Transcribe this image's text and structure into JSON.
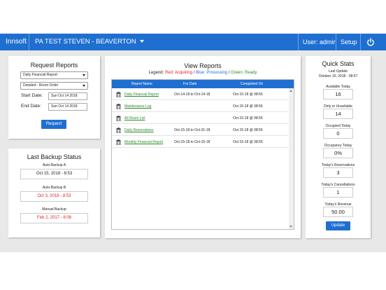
{
  "colors": {
    "accent": "#1f6fd1",
    "red": "#e02020",
    "blue": "#1f6fd1",
    "green": "#2a8a2a"
  },
  "header": {
    "brand": "Innsoft",
    "property": "PA TEST STEVEN - BEAVERTON",
    "user": "User: admin",
    "setup": "Setup",
    "power_icon": "power-icon"
  },
  "request": {
    "title": "Request Reports",
    "report_select": "Daily Financial Report",
    "order_select": "Detailed - Room Order",
    "start_label": "Start Date:",
    "start_value": "Sun Oct 14 2018",
    "end_label": "End Date:",
    "end_value": "Sun Oct 14 2018",
    "button": "Request"
  },
  "backup": {
    "title": "Last Backup Status",
    "items": [
      {
        "label": "Auto-Backup A",
        "value": "Oct 15, 2018 - 8:53",
        "color": "#222222"
      },
      {
        "label": "Auto-Backup B",
        "value": "Oct 3, 2018 - 8:53",
        "color": "#e02020"
      },
      {
        "label": "Manual Backup",
        "value": "Feb 2, 2017 - 8:08",
        "color": "#e02020"
      }
    ]
  },
  "view": {
    "title": "View Reports",
    "legend": {
      "prefix": "Legend: ",
      "red": "Red: Acquiring",
      "blue": "Blue: Processing",
      "green": "Green: Ready"
    },
    "columns": [
      "Report Name",
      "For Date",
      "Completed On"
    ],
    "rows": [
      {
        "name": "Daily Financial Report",
        "for_date": "Oct-14-18 to Oct-14-18",
        "completed": "Oct-15-18 @ 08:56"
      },
      {
        "name": "Maintenance Log",
        "for_date": "",
        "completed": "Oct-15-18 @ 08:56"
      },
      {
        "name": "All Room List",
        "for_date": "",
        "completed": "Oct-15-18 @ 08:55"
      },
      {
        "name": "Daily Reservations",
        "for_date": "Oct-15-18 to Oct-31-18",
        "completed": "Oct-15-18 @ 08:55"
      },
      {
        "name": "Monthly Financial Report",
        "for_date": "Oct-15-18 to Oct-15-18",
        "completed": "Oct-15-18 @ 08:55"
      }
    ]
  },
  "quick_stats": {
    "title": "Quick Stats",
    "last_update_label": "Last Update",
    "last_update_value": "October 15, 2018 - 08:57",
    "stats": [
      {
        "label": "Available Today",
        "value": "16"
      },
      {
        "label": "Dirty or Unavilable",
        "value": "14"
      },
      {
        "label": "Occupied Today",
        "value": "0"
      },
      {
        "label": "Occupancy Today",
        "value": "0%"
      },
      {
        "label": "Today's Reservations",
        "value": "3"
      },
      {
        "label": "Today's Cancellations",
        "value": "1"
      },
      {
        "label": "Today's Revenue",
        "value": "50.00"
      }
    ],
    "button": "Update"
  }
}
